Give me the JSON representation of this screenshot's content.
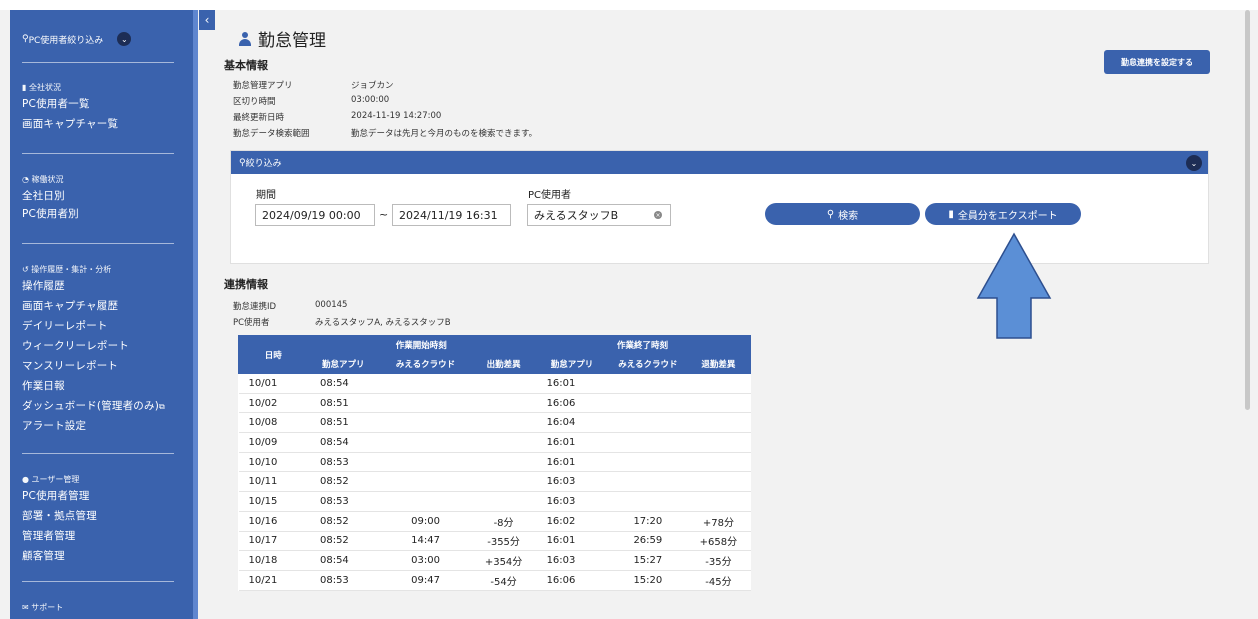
{
  "sidebar": {
    "filter_label": "PC使用者絞り込み",
    "groups": [
      {
        "head": "全社状況",
        "items": [
          "PC使用者一覧",
          "画面キャプチャー覧"
        ]
      },
      {
        "head": "稼働状況",
        "items": [
          "全社日別",
          "PC使用者別"
        ]
      },
      {
        "head": "操作履歴・集計・分析",
        "items": [
          "操作履歴",
          "画面キャプチャ履歴",
          "デイリーレポート",
          "ウィークリーレポート",
          "マンスリーレポート",
          "作業日報",
          "ダッシュボード(管理者のみ)",
          "アラート設定"
        ]
      },
      {
        "head": "ユーザー管理",
        "items": [
          "PC使用者管理",
          "部署・拠点管理",
          "管理者管理",
          "顧客管理"
        ]
      },
      {
        "head": "サポート",
        "items": []
      }
    ]
  },
  "page": {
    "title": "勤怠管理",
    "setting_button": "勤怠連携を設定する"
  },
  "basic_info": {
    "title": "基本情報",
    "rows": [
      {
        "label": "勤怠管理アプリ",
        "value": "ジョブカン"
      },
      {
        "label": "区切り時間",
        "value": "03:00:00"
      },
      {
        "label": "最終更新日時",
        "value": "2024-11-19 14:27:00"
      },
      {
        "label": "勤怠データ検索範囲",
        "value": "勤怠データは先月と今月のものを検索できます。"
      }
    ]
  },
  "filter": {
    "header": "絞り込み",
    "period_label": "期間",
    "period_from": "2024/09/19 00:00",
    "period_sep": "~",
    "period_to": "2024/11/19 16:31",
    "user_label": "PC使用者",
    "user_value": "みえるスタッフB",
    "search_button": "検索",
    "export_button": "全員分をエクスポート"
  },
  "link_info": {
    "title": "連携情報",
    "rows": [
      {
        "label": "勤怠連携ID",
        "value": "000145"
      },
      {
        "label": "PC使用者",
        "value": "みえるスタッフA, みえるスタッフB"
      }
    ]
  },
  "table": {
    "date_header": "日時",
    "start_group": "作業開始時刻",
    "end_group": "作業終了時刻",
    "sub_headers": [
      "勤怠アプリ",
      "みえるクラウド",
      "出勤差異",
      "勤怠アプリ",
      "みえるクラウド",
      "退勤差異"
    ],
    "rows": [
      [
        "10/01",
        "08:54",
        "",
        "",
        "16:01",
        "",
        ""
      ],
      [
        "10/02",
        "08:51",
        "",
        "",
        "16:06",
        "",
        ""
      ],
      [
        "10/08",
        "08:51",
        "",
        "",
        "16:04",
        "",
        ""
      ],
      [
        "10/09",
        "08:54",
        "",
        "",
        "16:01",
        "",
        ""
      ],
      [
        "10/10",
        "08:53",
        "",
        "",
        "16:01",
        "",
        ""
      ],
      [
        "10/11",
        "08:52",
        "",
        "",
        "16:03",
        "",
        ""
      ],
      [
        "10/15",
        "08:53",
        "",
        "",
        "16:03",
        "",
        ""
      ],
      [
        "10/16",
        "08:52",
        "09:00",
        "-8分",
        "16:02",
        "17:20",
        "+78分"
      ],
      [
        "10/17",
        "08:52",
        "14:47",
        "-355分",
        "16:01",
        "26:59",
        "+658分"
      ],
      [
        "10/18",
        "08:54",
        "03:00",
        "+354分",
        "16:03",
        "15:27",
        "-35分"
      ],
      [
        "10/21",
        "08:53",
        "09:47",
        "-54分",
        "16:06",
        "15:20",
        "-45分"
      ]
    ]
  },
  "colors": {
    "primary": "#3a62ad",
    "dark": "#1d2d55",
    "arrow": "#5b8fd6"
  }
}
